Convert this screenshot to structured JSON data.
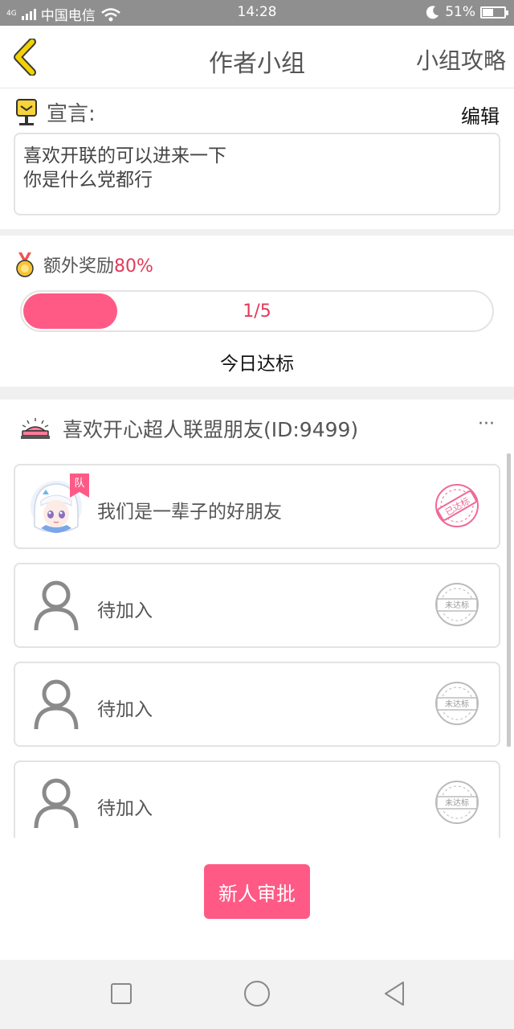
{
  "status_bar": {
    "network": "4G",
    "carrier": "中国电信",
    "time": "14:28",
    "battery": "51%",
    "battery_level": 0.51
  },
  "header": {
    "title": "作者小组",
    "guide_link": "小组攻略"
  },
  "declaration": {
    "label": "宣言:",
    "edit_label": "编辑",
    "lines": [
      "喜欢开联的可以进来一下",
      "你是什么党都行"
    ]
  },
  "reward": {
    "label": "额外奖励",
    "percent": "80%",
    "progress_text": "1/5",
    "progress_fraction": 0.2,
    "status": "今日达标"
  },
  "group": {
    "name": "喜欢开心超人联盟朋友(ID:9499)",
    "more": "···",
    "members": [
      {
        "name": "我们是一辈子的好朋友",
        "leader_badge": "队",
        "stamp": "已达标",
        "has_avatar": true
      },
      {
        "name": "待加入",
        "stamp": "未达标",
        "has_avatar": false
      },
      {
        "name": "待加入",
        "stamp": "未达标",
        "has_avatar": false
      },
      {
        "name": "待加入",
        "stamp": "未达标",
        "has_avatar": false
      }
    ]
  },
  "approve_button": "新人审批",
  "colors": {
    "accent": "#ff5a86",
    "accent_text": "#e23a5a",
    "back_arrow": "#f5d100"
  },
  "icons": [
    "back-arrow-icon",
    "mailbox-icon",
    "medal-icon",
    "group-emblem-icon",
    "user-placeholder-icon",
    "stamp-icon",
    "nav-square-icon",
    "nav-circle-icon",
    "nav-triangle-icon"
  ]
}
